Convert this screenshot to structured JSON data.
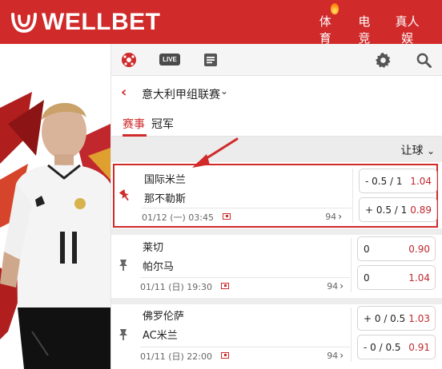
{
  "brand": {
    "name": "WELLBET",
    "color": "#d02a2a"
  },
  "nav": [
    {
      "label": "体育",
      "icon": "flame-icon"
    },
    {
      "label": "电竞"
    },
    {
      "label": "真人娱"
    }
  ],
  "toolbar": {
    "soccer_icon": "soccer-ball-icon",
    "live_label": "LIVE",
    "list_icon": "list-icon",
    "settings_icon": "gear-icon",
    "search_icon": "search-icon"
  },
  "league": {
    "name": "意大利甲组联赛",
    "back_icon": "chevron-left-icon",
    "dropdown_icon": "chevron-down-icon"
  },
  "tabs": [
    {
      "label": "赛事",
      "active": true
    },
    {
      "label": "冠军",
      "active": false
    }
  ],
  "filter": {
    "label": "让球",
    "icon": "chevron-down-icon"
  },
  "matches": [
    {
      "home": "国际米兰",
      "away": "那不勒斯",
      "datetime": "01/12 (一) 03:45",
      "more_count": "94",
      "pinned": true,
      "odds": [
        {
          "handicap": "- 0.5 / 1",
          "price": "1.04"
        },
        {
          "handicap": "+ 0.5 / 1",
          "price": "0.89"
        }
      ]
    },
    {
      "home": "莱切",
      "away": "帕尔马",
      "datetime": "01/11 (日) 19:30",
      "more_count": "94",
      "pinned": false,
      "odds": [
        {
          "handicap": "0",
          "price": "0.90"
        },
        {
          "handicap": "0",
          "price": "1.04"
        }
      ]
    },
    {
      "home": "佛罗伦萨",
      "away": "AC米兰",
      "datetime": "01/11 (日) 22:00",
      "more_count": "94",
      "pinned": false,
      "odds": [
        {
          "handicap": "+ 0 / 0.5",
          "price": "1.03"
        },
        {
          "handicap": "- 0 / 0.5",
          "price": "0.91"
        }
      ]
    }
  ],
  "colors": {
    "accent": "#d02a2a",
    "price": "#c0282d",
    "toolbar_bg": "#f5f5f5"
  }
}
